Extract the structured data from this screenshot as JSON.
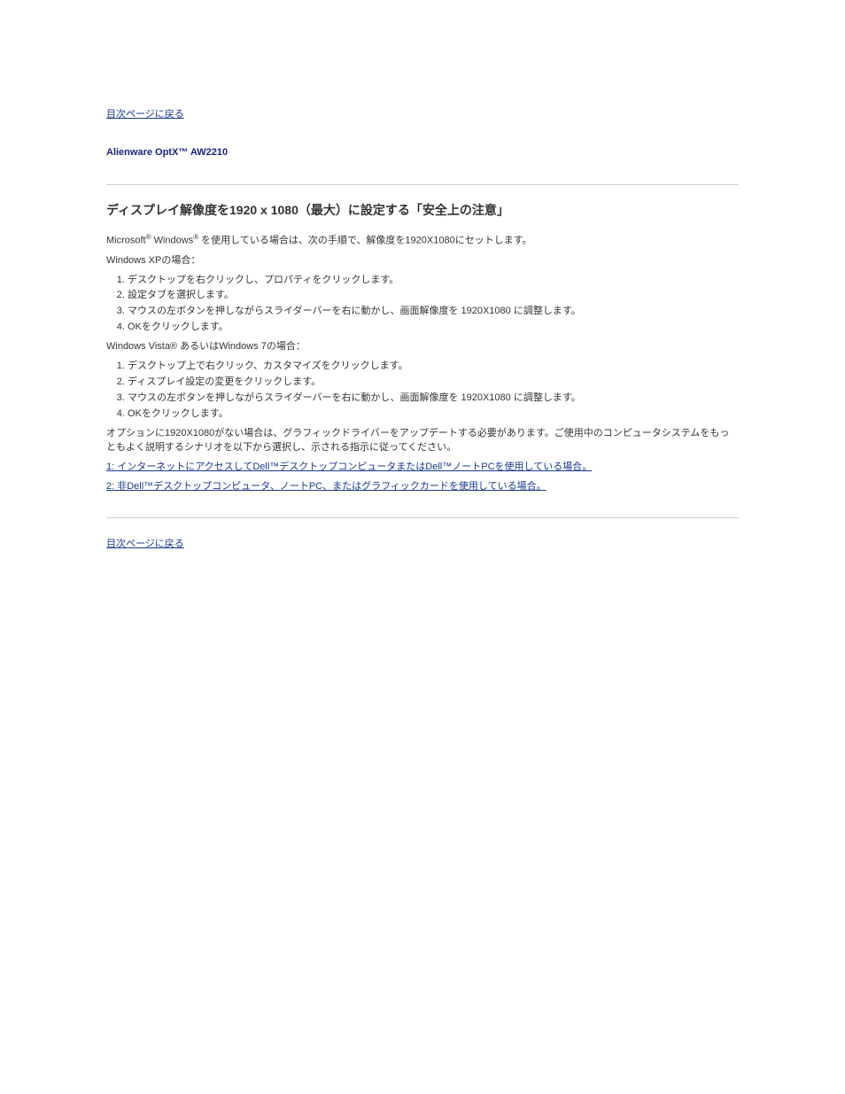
{
  "nav": {
    "back_top": "目次ページに戻る",
    "back_bottom": "目次ページに戻る"
  },
  "heading_model": "Alienware OptX™ AW2210",
  "heading_resolution": "ディスプレイ解像度を1920 x 1080（最大）に設定する「安全上の注意」",
  "intro": {
    "line1_prefix": "Microsoft",
    "reg1": "®",
    "line1_mid": " Windows",
    "reg2": "®",
    "line1_suffix": " を使用している場合は、次の手順で、解像度を1920X1080にセットします。"
  },
  "win7_label": "Windows XPの場合：",
  "steps_xp": [
    "デスクトップを右クリックし、プロパティをクリックします。",
    "設定タブを選択します。",
    "マウスの左ボタンを押しながらスライダーバーを右に動かし、画面解像度を 1920X1080 に調整します。",
    "OKをクリックします。"
  ],
  "winvista_label": "Windows Vista® あるいはWindows 7の場合：",
  "steps_vista": [
    "デスクトップ上で右クリック、カスタマイズをクリックします。",
    "ディスプレイ設定の変更をクリックします。",
    "マウスの左ボタンを押しながらスライダーバーを右に動かし、画面解像度を 1920X1080 に調整します。",
    "OKをクリックします。"
  ],
  "outro": {
    "paragraph": "オプションに1920X1080がない場合は、グラフィックドライバーをアップデートする必要があります。ご使用中のコンピュータシステムをもっともよく説明するシナリオを以下から選択し、示される指示に従ってください。",
    "link1": "1: インターネットにアクセスしてDell™デスクトップコンピュータまたはDell™ノートPCを使用している場合。",
    "link2": "2: 非Dell™デスクトップコンピュータ、ノートPC、またはグラフィックカードを使用している場合。"
  }
}
